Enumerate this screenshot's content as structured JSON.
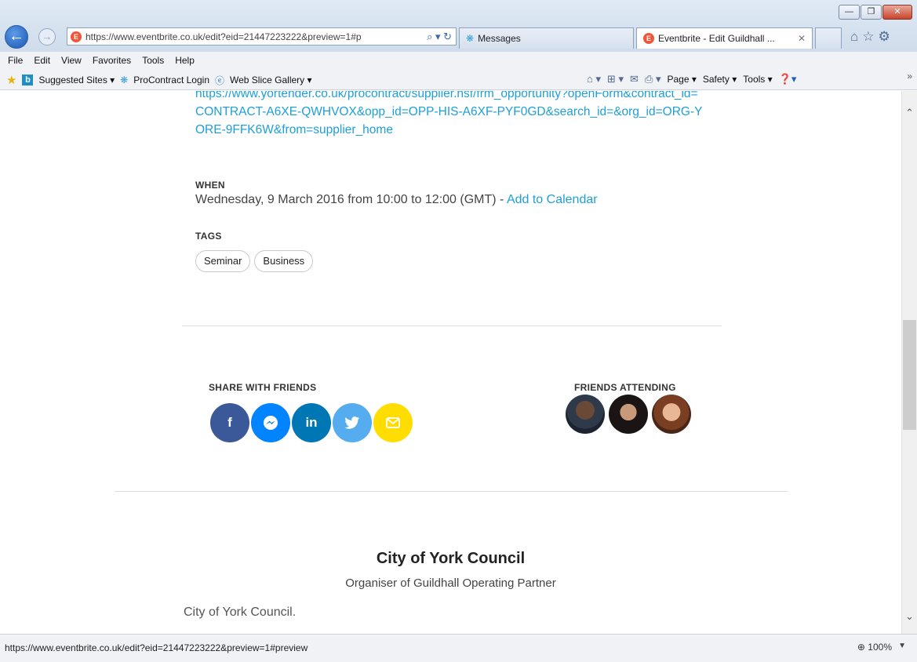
{
  "browser": {
    "address_url": "https://www.eventbrite.co.uk/edit?eid=21447223222&preview=1#p",
    "tabs": [
      {
        "label": "Messages"
      },
      {
        "label": "Eventbrite - Edit Guildhall ..."
      }
    ],
    "window_buttons": [
      "—",
      "❐",
      "✕"
    ]
  },
  "menu": [
    "File",
    "Edit",
    "View",
    "Favorites",
    "Tools",
    "Help"
  ],
  "favorites": {
    "items": [
      "Suggested Sites ▾",
      "ProContract Login",
      "Web Slice Gallery ▾"
    ],
    "commands": [
      "Page ▾",
      "Safety ▾",
      "Tools ▾"
    ]
  },
  "event": {
    "link_text": "https://www.yortender.co.uk/procontract/supplier.nsf/frm_opportunity?openForm&contract_id=CONTRACT-A6XE-QWHVOX&opp_id=OPP-HIS-A6XF-PYF0GD&search_id=&org_id=ORG-YORE-9FFK6W&from=supplier_home",
    "when_label": "WHEN",
    "when_text": "Wednesday, 9 March 2016 from 10:00 to 12:00 (GMT) - ",
    "add_calendar": "Add to Calendar",
    "tags_label": "TAGS",
    "tags": [
      "Seminar",
      "Business"
    ]
  },
  "share": {
    "label": "SHARE WITH FRIENDS",
    "buttons": [
      {
        "name": "facebook",
        "glyph": "f",
        "color": "#3b5998"
      },
      {
        "name": "messenger",
        "glyph": "⌁",
        "color": "#0084ff"
      },
      {
        "name": "linkedin",
        "glyph": "in",
        "color": "#0077b5"
      },
      {
        "name": "twitter",
        "glyph": "🐦",
        "color": "#55acee"
      },
      {
        "name": "email",
        "glyph": "✉",
        "color": "#ffdd00"
      }
    ]
  },
  "friends": {
    "label": "FRIENDS ATTENDING",
    "count": 3
  },
  "organiser": {
    "name": "City of York Council",
    "subtitle": "Organiser of Guildhall Operating Partner",
    "description": "City of York Council."
  },
  "status": {
    "url": "https://www.eventbrite.co.uk/edit?eid=21447223222&preview=1#preview",
    "zoom": "100%"
  }
}
